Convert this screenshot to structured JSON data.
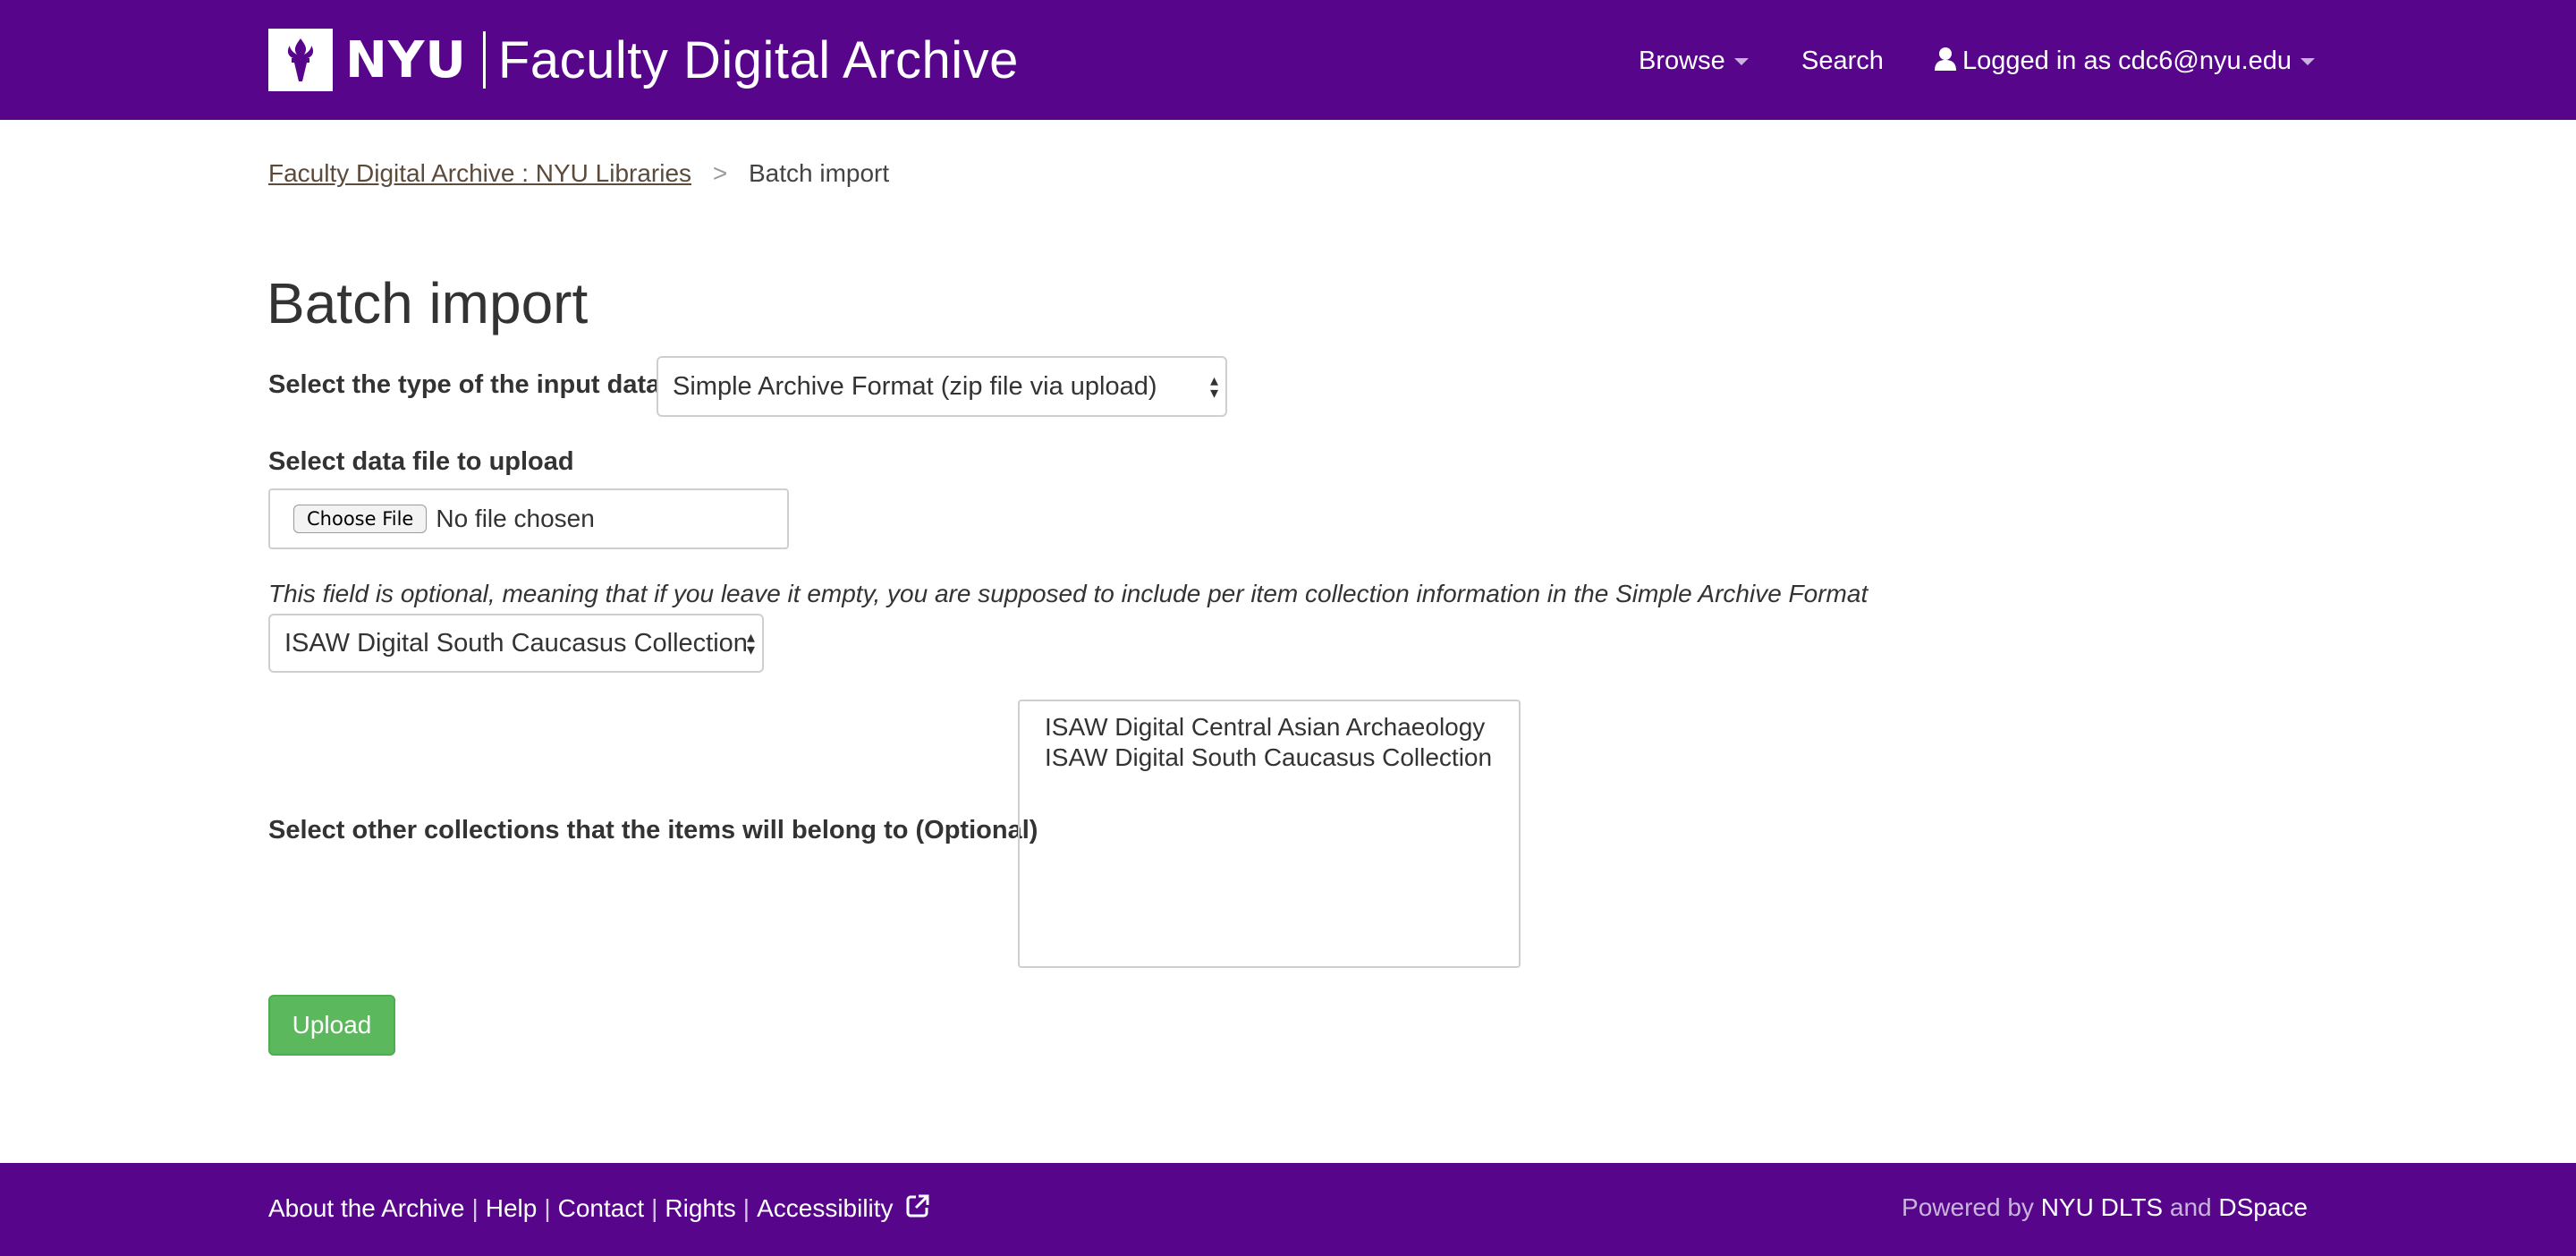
{
  "header": {
    "logo_text": "NYU",
    "site_title": "Faculty Digital Archive",
    "nav": {
      "browse": "Browse",
      "search": "Search",
      "user": "Logged in as cdc6@nyu.edu"
    }
  },
  "breadcrumb": {
    "home": "Faculty Digital Archive : NYU Libraries",
    "separator": ">",
    "current": "Batch import"
  },
  "page": {
    "title": "Batch import",
    "input_type_label": "Select the type of the input data",
    "input_type_value": "Simple Archive Format (zip file via upload)",
    "file_label": "Select data file to upload",
    "choose_file": "Choose File",
    "no_file": "No file chosen",
    "optional_help": "This field is optional, meaning that if you leave it empty, you are supposed to include per item collection information in the Simple Archive Format",
    "collection_value": "ISAW Digital South Caucasus Collection",
    "other_collections_label": "Select other collections that the items will belong to (Optional)",
    "other_collections_options": [
      "ISAW Digital Central Asian Archaeology",
      "ISAW Digital South Caucasus Collection"
    ],
    "upload_button": "Upload"
  },
  "footer": {
    "links": [
      "About the Archive",
      "Help",
      "Contact",
      "Rights",
      "Accessibility"
    ],
    "powered_prefix": "Powered by",
    "powered_dlts": "NYU DLTS",
    "powered_and": "and",
    "powered_dspace": "DSpace"
  },
  "colors": {
    "nyu_purple": "#57068c",
    "upload_green": "#5cb85c"
  }
}
